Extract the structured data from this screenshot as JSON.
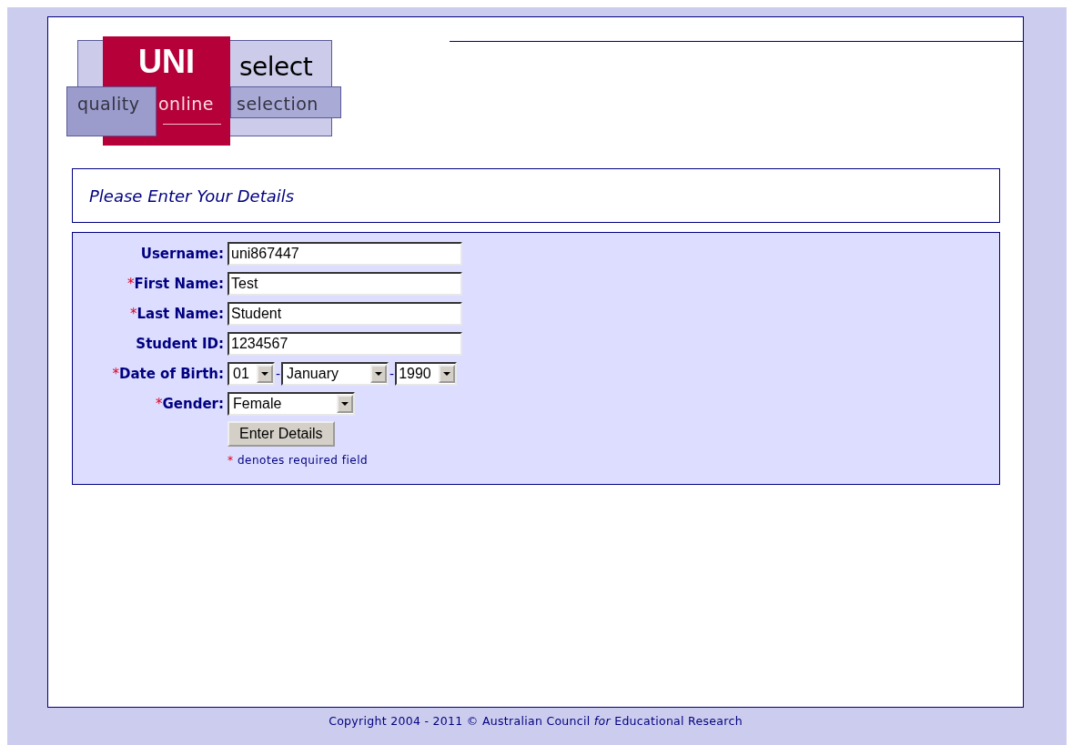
{
  "logo": {
    "word_1": "UNI",
    "word_2": "select",
    "tagline": [
      "quality",
      "online",
      "selection"
    ]
  },
  "heading": "Please Enter Your Details",
  "form": {
    "required_mark": "*",
    "fields": [
      {
        "kind": "text",
        "label": "Username:",
        "required": false,
        "value": "uni867447"
      },
      {
        "kind": "text",
        "label": "First Name:",
        "required": true,
        "value": "Test"
      },
      {
        "kind": "text",
        "label": "Last Name:",
        "required": true,
        "value": "Student"
      },
      {
        "kind": "text",
        "label": "Student ID:",
        "required": false,
        "value": "1234567"
      },
      {
        "kind": "date",
        "label": "Date of Birth:",
        "required": true,
        "parts": [
          "01",
          "January",
          "1990"
        ],
        "separators": [
          "-",
          "-"
        ]
      },
      {
        "kind": "select",
        "label": "Gender:",
        "required": true,
        "value": "Female"
      }
    ],
    "submit": "Enter Details",
    "note": {
      "mark": "*",
      "text": "denotes required field"
    }
  },
  "footer": "Copyright 2004 - 2011 © Australian Council *for* Educational Research"
}
